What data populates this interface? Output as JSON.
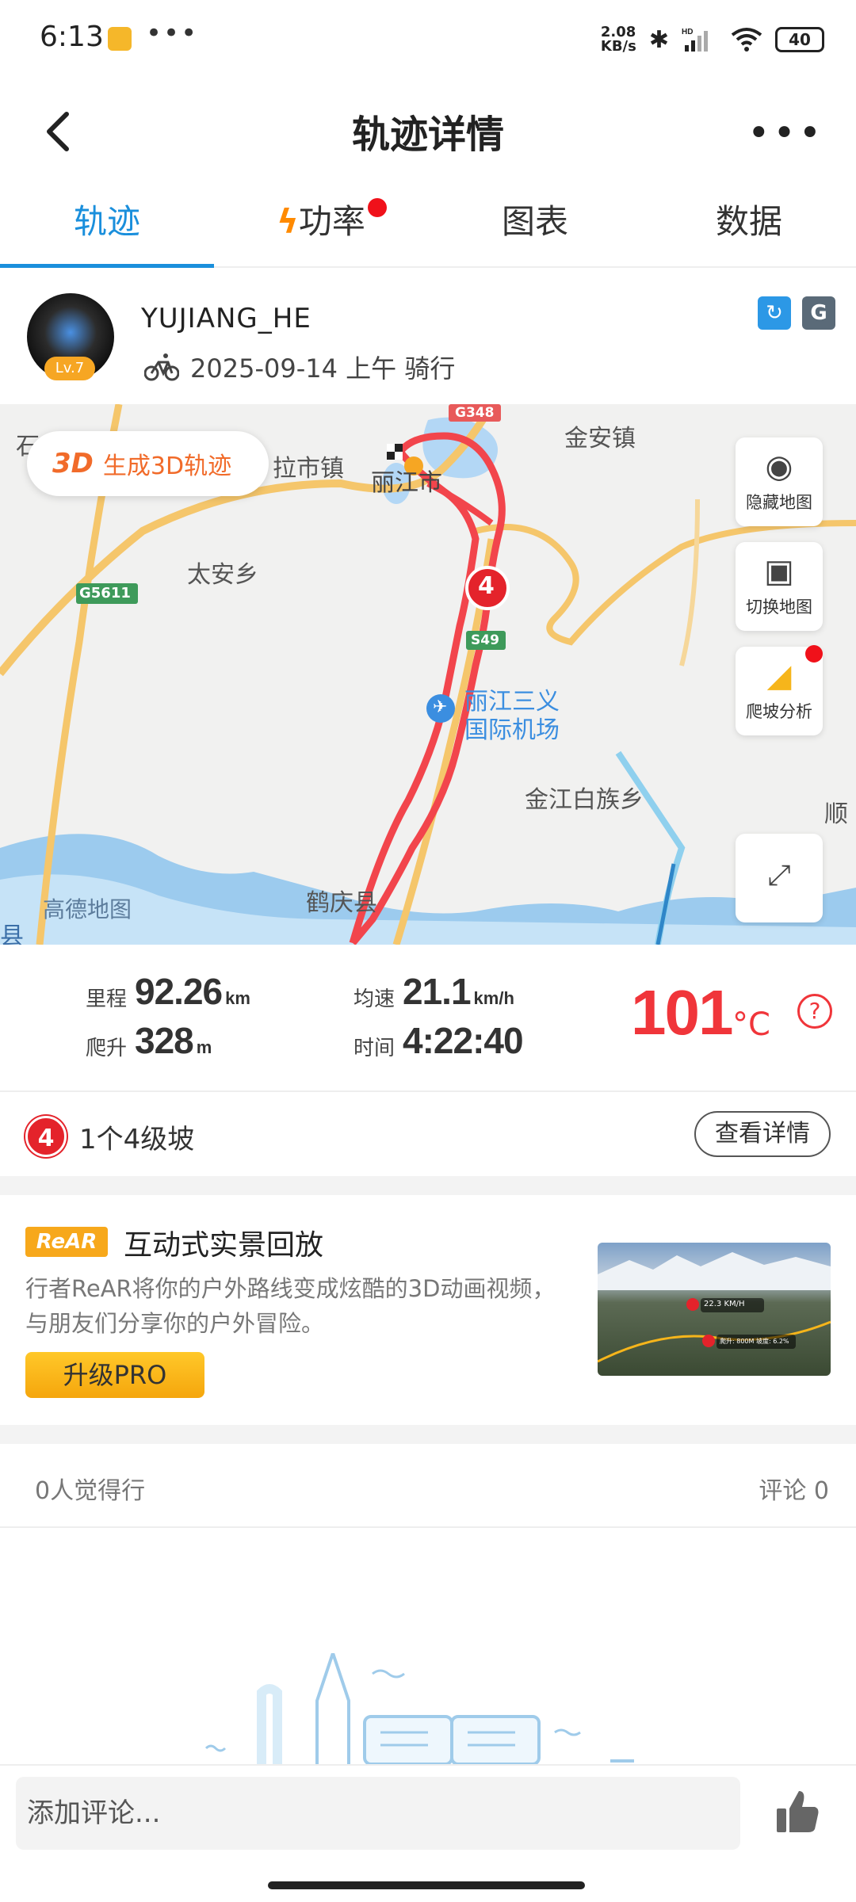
{
  "status_bar": {
    "time": "6:13",
    "net_speed_top": "2.08",
    "net_speed_bottom": "KB/s",
    "battery": "40"
  },
  "header": {
    "title": "轨迹详情"
  },
  "tabs": [
    {
      "label": "轨迹",
      "active": true
    },
    {
      "label": "功率",
      "has_dot": true
    },
    {
      "label": "图表"
    },
    {
      "label": "数据"
    }
  ],
  "user": {
    "name": "YUJIANG_HE",
    "level": "Lv.7",
    "date": "2025-09-14 上午 骑行"
  },
  "map": {
    "btn_3d": "生成3D轨迹",
    "btn_3d_prefix": "3D",
    "controls": {
      "hide": "隐藏地图",
      "switch": "切换地图",
      "climb": "爬坡分析"
    },
    "labels": {
      "lijiang": "丽江市",
      "jinan": "金安镇",
      "lashi": "拉市镇",
      "taian": "太安乡",
      "airport1": "丽江三义",
      "airport2": "国际机场",
      "jinjiang": "金江白族乡",
      "heqing": "鹤庆县",
      "shi": "石",
      "shun": "顺",
      "xian": "县",
      "g5611": "G5611",
      "g348": "G348",
      "s49": "S49",
      "gaode": "高德地图"
    },
    "climb_marker": "4"
  },
  "stats": {
    "distance": {
      "label": "里程",
      "value": "92.26",
      "unit": "km"
    },
    "ascent": {
      "label": "爬升",
      "value": "328",
      "unit": "m"
    },
    "avg_speed": {
      "label": "均速",
      "value": "21.1",
      "unit": "km/h"
    },
    "time": {
      "label": "时间",
      "value": "4:22:40"
    },
    "temperature": {
      "value": "101",
      "unit": "°C"
    }
  },
  "climb": {
    "badge": "4",
    "text": "1个4级坡",
    "button": "查看详情"
  },
  "rear": {
    "tag": "ReAR",
    "title": "互动式实景回放",
    "description": "行者ReAR将你的户外路线变成炫酷的3D动画视频，与朋友们分享你的户外冒险。",
    "upgrade": "升级PRO",
    "thumb_speed": "22.3 KM/H",
    "thumb_hc": "爬升: 800M  坡度: 6.2%"
  },
  "social": {
    "likes": "0人觉得行",
    "comments": "评论 0"
  },
  "comment": {
    "placeholder": "添加评论..."
  }
}
